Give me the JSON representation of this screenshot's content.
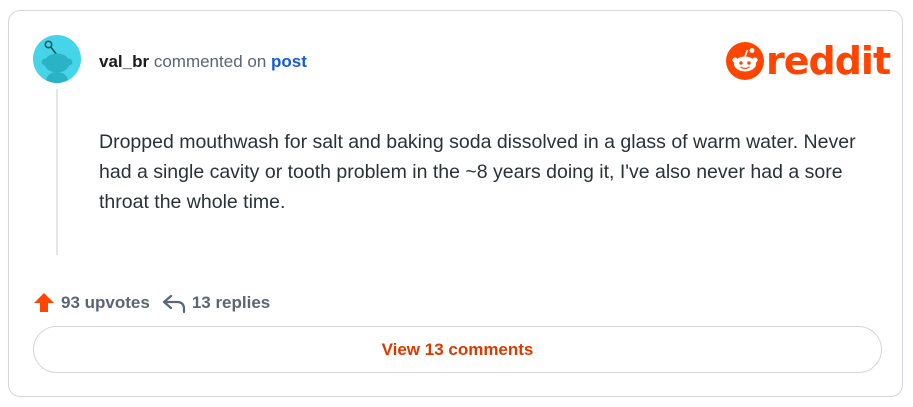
{
  "comment": {
    "username": "val_br",
    "action_text": "commented on",
    "post_link_text": "post",
    "body": "Dropped mouthwash for salt and baking soda dissolved in a glass of warm water. Never had a single cavity or tooth problem in the ~8 years doing it, I've also never had a sore throat the whole time."
  },
  "brand": {
    "logo_text": "reddit",
    "logo_icon": "reddit-snoo-icon",
    "color": "#ff4500"
  },
  "stats": {
    "upvotes_label": "93 upvotes",
    "replies_label": "13 replies",
    "upvote_icon": "upvote-arrow-icon",
    "reply_icon": "reply-arrow-icon",
    "upvote_color": "#ff4500"
  },
  "actions": {
    "view_comments_label": "View 13 comments"
  },
  "avatar": {
    "icon": "snoo-avatar-icon",
    "background": "#46d4e8"
  }
}
